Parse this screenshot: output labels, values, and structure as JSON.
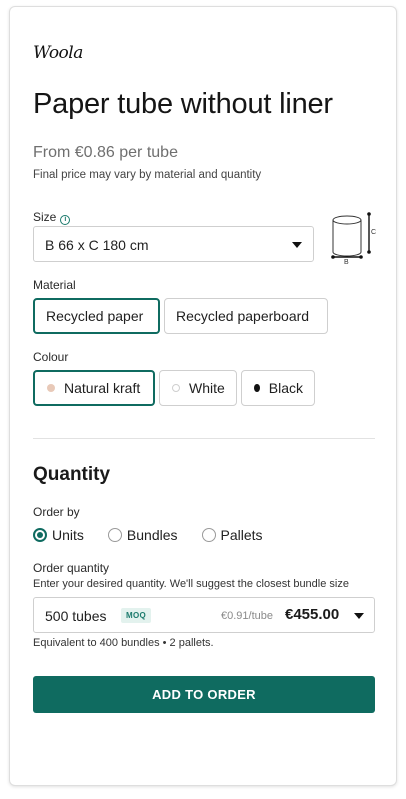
{
  "brand": {
    "logo_text": "Woola"
  },
  "product": {
    "title": "Paper tube without liner",
    "price": "From €0.86 per tube",
    "price_note": "Final price may vary by material and quantity"
  },
  "size": {
    "label": "Size",
    "selected": "B 66 x C 180 cm",
    "diagram_labels": {
      "height": "C",
      "width": "B"
    }
  },
  "material": {
    "label": "Material",
    "options": [
      {
        "label": "Recycled paper",
        "selected": true
      },
      {
        "label": "Recycled paperboard",
        "selected": false
      }
    ]
  },
  "colour": {
    "label": "Colour",
    "options": [
      {
        "label": "Natural kraft",
        "swatch": "#e8c9b8",
        "selected": true
      },
      {
        "label": "White",
        "swatch": "#ffffff",
        "selected": false
      },
      {
        "label": "Black",
        "swatch": "#111111",
        "selected": false
      }
    ]
  },
  "quantity": {
    "title": "Quantity",
    "order_by_label": "Order by",
    "order_by_options": [
      {
        "label": "Units",
        "selected": true
      },
      {
        "label": "Bundles",
        "selected": false
      },
      {
        "label": "Pallets",
        "selected": false
      }
    ],
    "order_quantity_label": "Order quantity",
    "hint": "Enter your desired quantity. We'll suggest the closest bundle size",
    "value": "500 tubes",
    "moq_badge": "MOQ",
    "unit_price": "€0.91/tube",
    "total": "€455.00",
    "equivalent": "Equivalent to 400 bundles • 2 pallets."
  },
  "cta": {
    "label": "ADD TO ORDER"
  },
  "colors": {
    "accent": "#0f6b60",
    "border": "#cfcfcf"
  }
}
